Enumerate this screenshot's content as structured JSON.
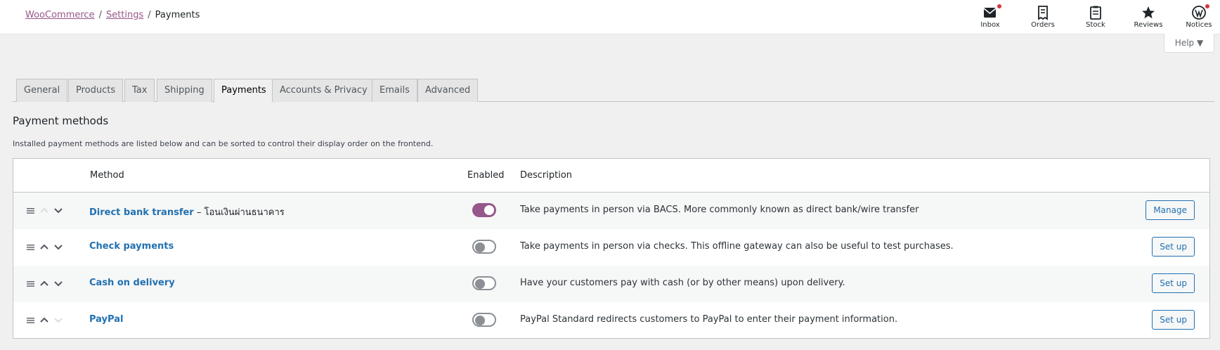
{
  "breadcrumb": {
    "root": "WooCommerce",
    "settings": "Settings",
    "current": "Payments",
    "separator": "/"
  },
  "activity_bar": [
    {
      "label": "Inbox",
      "icon": "inbox-icon"
    },
    {
      "label": "Orders",
      "icon": "orders-icon"
    },
    {
      "label": "Stock",
      "icon": "stock-icon"
    },
    {
      "label": "Reviews",
      "icon": "star-icon"
    },
    {
      "label": "Notices",
      "icon": "wordpress-icon"
    }
  ],
  "help": {
    "label": "Help ▼"
  },
  "tabs": [
    {
      "label": "General"
    },
    {
      "label": "Products"
    },
    {
      "label": "Tax"
    },
    {
      "label": "Shipping"
    },
    {
      "label": "Payments",
      "active": true
    },
    {
      "label": "Accounts & Privacy"
    },
    {
      "label": "Emails"
    },
    {
      "label": "Advanced"
    }
  ],
  "section": {
    "title": "Payment methods",
    "description": "Installed payment methods are listed below and can be sorted to control their display order on the frontend."
  },
  "table": {
    "headers": {
      "method": "Method",
      "enabled": "Enabled",
      "description": "Description"
    },
    "rows": [
      {
        "name": "Direct bank transfer",
        "suffix": " – โอนเงินผ่านธนาคาร",
        "enabled": true,
        "description": "Take payments in person via BACS. More commonly known as direct bank/wire transfer",
        "action": "Manage"
      },
      {
        "name": "Check payments",
        "suffix": "",
        "enabled": false,
        "description": "Take payments in person via checks. This offline gateway can also be useful to test purchases.",
        "action": "Set up"
      },
      {
        "name": "Cash on delivery",
        "suffix": "",
        "enabled": false,
        "description": "Have your customers pay with cash (or by other means) upon delivery.",
        "action": "Set up"
      },
      {
        "name": "PayPal",
        "suffix": "",
        "enabled": false,
        "description": "PayPal Standard redirects customers to PayPal to enter their payment information.",
        "action": "Set up"
      }
    ]
  },
  "colors": {
    "accent": "#96588a",
    "link": "#2271b1",
    "toggle_off": "#8c8f94",
    "notification": "#d63638"
  }
}
